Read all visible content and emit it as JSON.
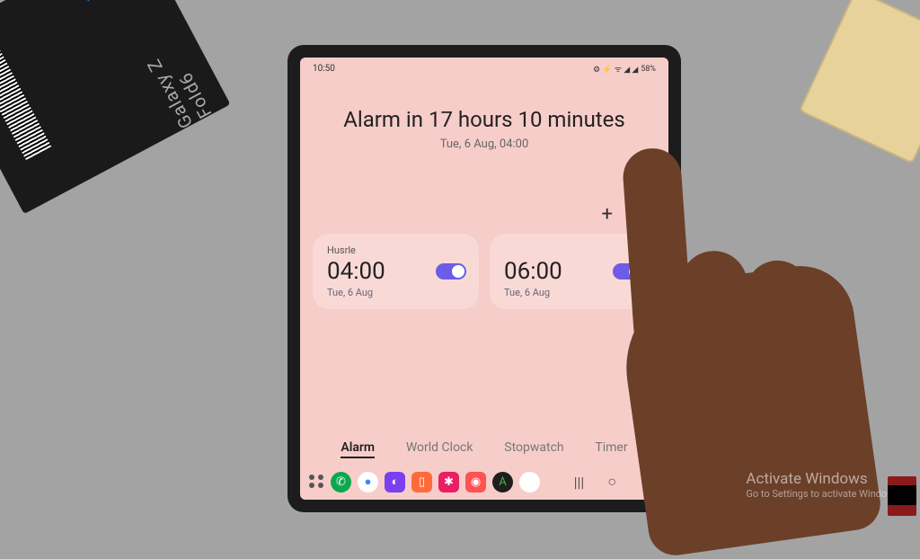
{
  "product_box": {
    "text": "Galaxy Z Fold6"
  },
  "statusbar": {
    "time": "10:50",
    "battery": "58%",
    "icons": "⚙ ⚡ ᯤ ◢ ◢"
  },
  "header": {
    "title": "Alarm in 17 hours 10 minutes",
    "subtitle": "Tue, 6 Aug, 04:00"
  },
  "actions": {
    "add": "+",
    "more": "⋮"
  },
  "alarms": [
    {
      "label": "Husrle",
      "time": "04:00",
      "date": "Tue, 6 Aug",
      "on": true
    },
    {
      "label": "",
      "time": "06:00",
      "date": "Tue, 6 Aug",
      "on": true
    }
  ],
  "tabs": {
    "alarm": "Alarm",
    "world": "World Clock",
    "stopwatch": "Stopwatch",
    "timer": "Timer"
  },
  "nav": {
    "recent": "|||",
    "home": "○",
    "back": "〈"
  },
  "dock_colors": [
    "#0aa84f",
    "#ffffff",
    "#7b3ff2",
    "#ff6a3d",
    "#00b894",
    "#e91e63",
    "#ff5252",
    "#2196f3",
    "#1e1e1e"
  ],
  "watermark": {
    "line1": "Activate Windows",
    "line2": "Go to Settings to activate Windows."
  }
}
